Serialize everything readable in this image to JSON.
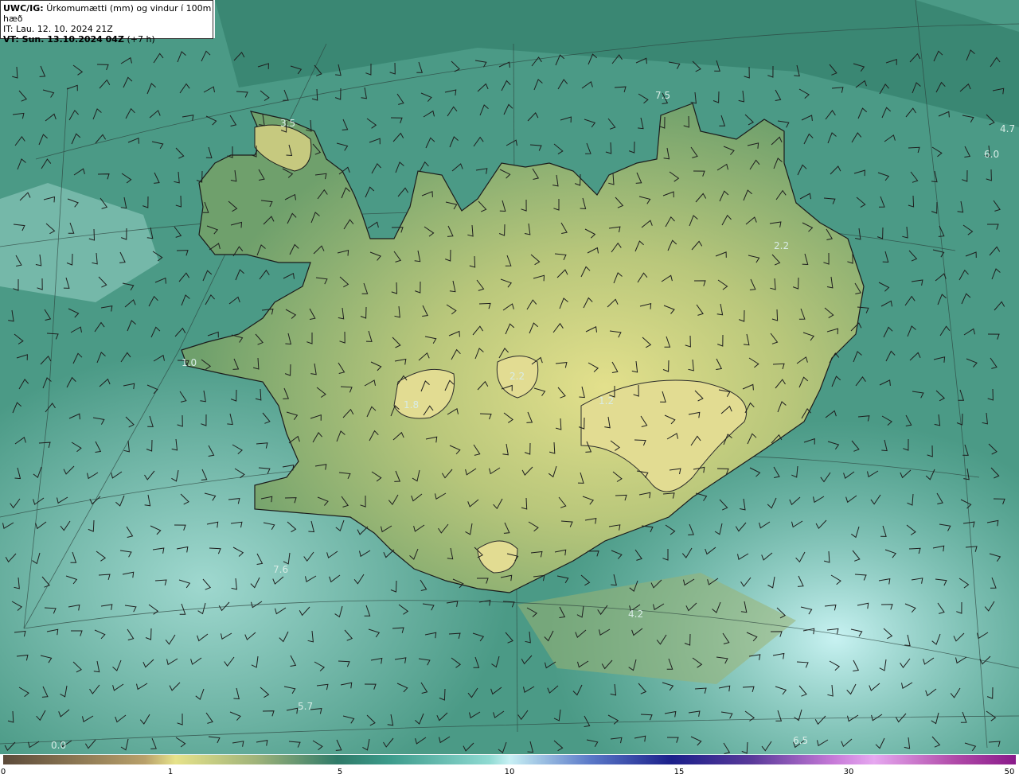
{
  "legend": {
    "model": "UWC/IG:",
    "description": "Úrkomumætti (mm) og vindur í 100m hæð",
    "it_line": "IT: Lau. 12. 10. 2024 21Z",
    "vt_prefix": "VT: Sun. 13.10.2024 04Z",
    "vt_suffix": "(+7 h)"
  },
  "colorbar": {
    "ticks": [
      "0",
      "1",
      "5",
      "10",
      "15",
      "30",
      "50"
    ]
  },
  "map_labels": [
    "7.5",
    "3.5",
    "4.7",
    "6.0",
    "2.2",
    "1.0",
    "1.2",
    "1.8",
    "2.2",
    "7.6",
    "4.2",
    "5.7",
    "6.5",
    "0.0"
  ],
  "colors": {
    "sea_dark": "#2f7d6b",
    "sea_mid": "#4f9e8a",
    "sea_light": "#9fd8cf",
    "land_mid": "#8fae6a",
    "land_light": "#d8db8a",
    "coast": "#1b1b1b",
    "barb": "#1e1e1e"
  }
}
